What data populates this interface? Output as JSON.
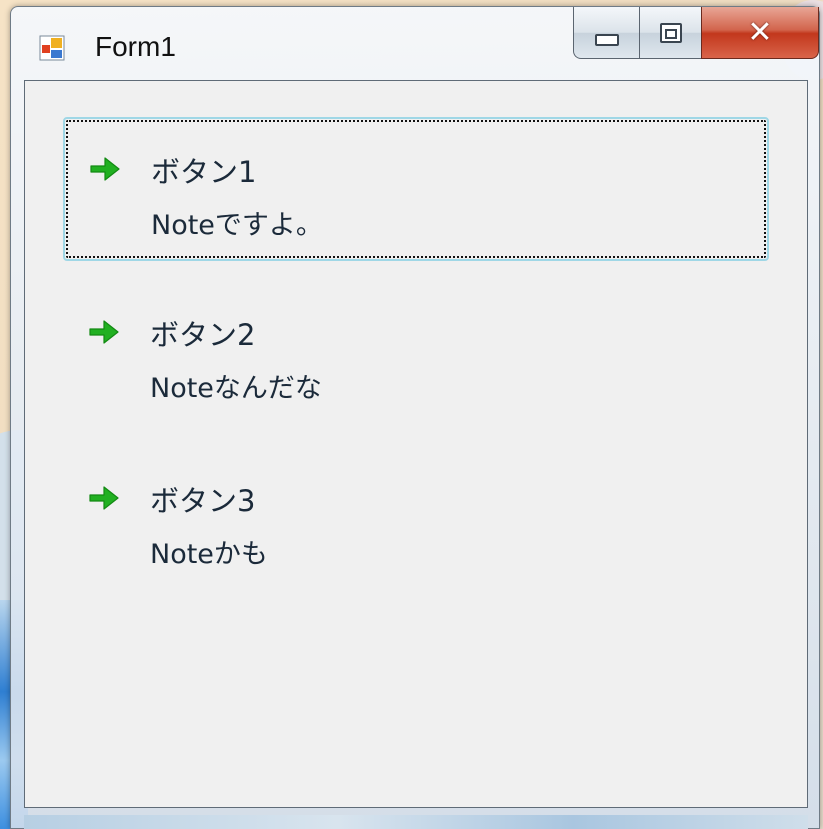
{
  "window": {
    "title": "Form1",
    "icon": "winforms-app-icon",
    "caption_buttons": {
      "minimize": "minimize-icon",
      "maximize": "maximize-icon",
      "close": "close-icon"
    }
  },
  "command_links": [
    {
      "title": "ボタン1",
      "note": "Noteですよ。",
      "icon": "green-arrow-icon",
      "focused": true
    },
    {
      "title": "ボタン2",
      "note": "Noteなんだな",
      "icon": "green-arrow-icon",
      "focused": false
    },
    {
      "title": "ボタン3",
      "note": "Noteかも",
      "icon": "green-arrow-icon",
      "focused": false
    }
  ],
  "colors": {
    "arrow_green": "#21b021",
    "client_background": "#f0f0f0",
    "focus_border": "#9fd7e6"
  }
}
